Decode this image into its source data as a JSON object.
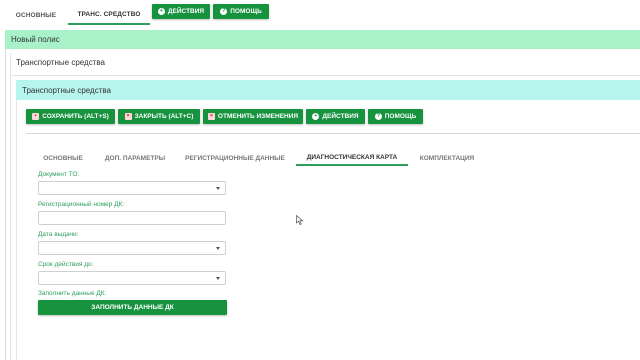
{
  "top_tabs": [
    {
      "label": "Основные"
    },
    {
      "label": "Транс. средство",
      "active": true
    }
  ],
  "top_actions": {
    "actions_label": "Действия",
    "help_label": "Помощь"
  },
  "polis_bar": {
    "title": "Новый полис"
  },
  "vehicles_section": {
    "header": "Транспортные средства",
    "subbar_title": "Транспортные средства"
  },
  "toolbar": {
    "save_label": "Сохранить (ALT+S)",
    "close_label": "Закрыть (ALT+C)",
    "cancel_label": "Отменить изменения",
    "actions_label": "Действия",
    "help_label": "Помощь"
  },
  "tabs": [
    {
      "label": "Основные"
    },
    {
      "label": "Доп. параметры"
    },
    {
      "label": "Регистрационные данные"
    },
    {
      "label": "Диагностическая карта",
      "active": true
    },
    {
      "label": "Комплектация"
    }
  ],
  "form": {
    "doc_to_label": "Документ ТО:",
    "doc_to_value": "",
    "reg_number_label": "Регистрационный номер ДК:",
    "reg_number_value": "",
    "issue_date_label": "Дата выдачи:",
    "issue_date_value": "",
    "valid_until_label": "Срок действия до:",
    "valid_until_value": "",
    "fill_label": "Заполнить данные ДК:",
    "fill_button_label": "Заполнить данные ДК"
  },
  "colors": {
    "accent_green": "#17923f",
    "polis_bar": "#a8f1c9",
    "section_bar": "#b6f4ee"
  }
}
